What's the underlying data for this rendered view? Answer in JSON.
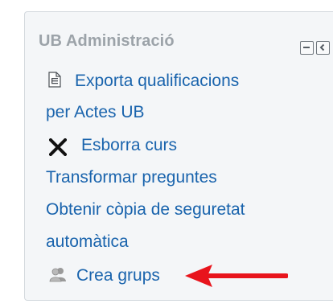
{
  "block": {
    "title": "UB Administració",
    "controls": {
      "hide": "minus-icon",
      "dock": "chevron-left-icon"
    }
  },
  "items": [
    {
      "icon": "document-icon",
      "lines": [
        "Exporta qualificacions",
        "per Actes UB"
      ]
    },
    {
      "icon": "close-x-icon",
      "lines": [
        "Esborra curs"
      ]
    },
    {
      "icon": null,
      "lines": [
        "Transformar preguntes"
      ]
    },
    {
      "icon": null,
      "lines": [
        "Obtenir còpia de seguretat",
        "automàtica"
      ]
    },
    {
      "icon": "group-icon",
      "lines": [
        "Crea grups"
      ]
    }
  ],
  "annotation": {
    "icon": "red-arrow-icon",
    "color": "#e8141c",
    "points_to": "Crea grups"
  },
  "colors": {
    "link": "#1a64ad",
    "title": "#9ca3a9",
    "block_background": "#f4f6f8"
  }
}
